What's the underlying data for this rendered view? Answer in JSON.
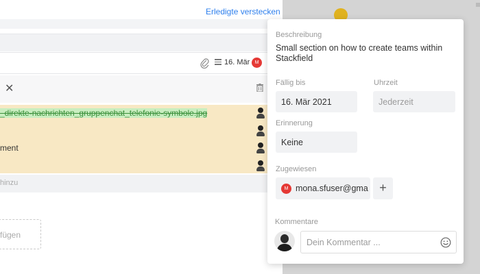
{
  "header": {
    "hide_completed_link": "Erledigte verstecken"
  },
  "task": {
    "due_label": "16. Mär",
    "assignee_initial": "M"
  },
  "attachments": {
    "file_name": "_direkte-nachrichten_gruppenchat_telefonie-symbole.jpg",
    "partial_text": "ment"
  },
  "subtask": {
    "add_placeholder": "hinzu"
  },
  "dropzone": {
    "label": "fügen"
  },
  "popover": {
    "description_label": "Beschreibung",
    "description_text": "Small section on how to create teams within Stackfield",
    "due_label": "Fällig bis",
    "due_value": "16. Mär 2021",
    "time_label": "Uhrzeit",
    "time_value": "Jederzeit",
    "reminder_label": "Erinnerung",
    "reminder_value": "Keine",
    "assigned_label": "Zugewiesen",
    "assignee_initial": "M",
    "assignee_name": "mona.sfuser@gma",
    "add_symbol": "+",
    "comments_label": "Kommentare",
    "comment_placeholder": "Dein Kommentar ..."
  },
  "colors": {
    "accent": "#2f80ed",
    "avatar_red": "#e53935",
    "attachment_bg": "#f8e8c4"
  },
  "icons": [
    "paperclip-icon",
    "description-icon",
    "close-icon",
    "trash-icon",
    "smiley-icon",
    "plus-icon"
  ]
}
